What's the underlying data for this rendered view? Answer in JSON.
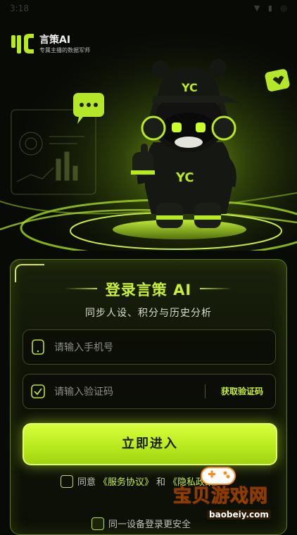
{
  "status_bar": {
    "time": "3:18",
    "icons": "▼ ▮ ◎"
  },
  "brand": {
    "title": "言策AI",
    "subtitle": "专属主播的数据军师"
  },
  "login": {
    "title": "登录言策 AI",
    "subtitle": "同步人设、积分与历史分析",
    "phone_placeholder": "请输入手机号",
    "code_placeholder": "请输入验证码",
    "get_code_label": "获取验证码",
    "enter_button": "立即进入"
  },
  "agreement": {
    "prefix": "同意",
    "service_link": "《服务协议》",
    "and": "和",
    "privacy_link": "《隐私政策》"
  },
  "secure_login": {
    "label": "同一设备登录更安全"
  },
  "watermark": {
    "text": "宝贝游戏网",
    "url": "baobeiy.com"
  },
  "colors": {
    "accent": "#c9f033",
    "background": "#080a06",
    "button": "#b9ea1e"
  }
}
